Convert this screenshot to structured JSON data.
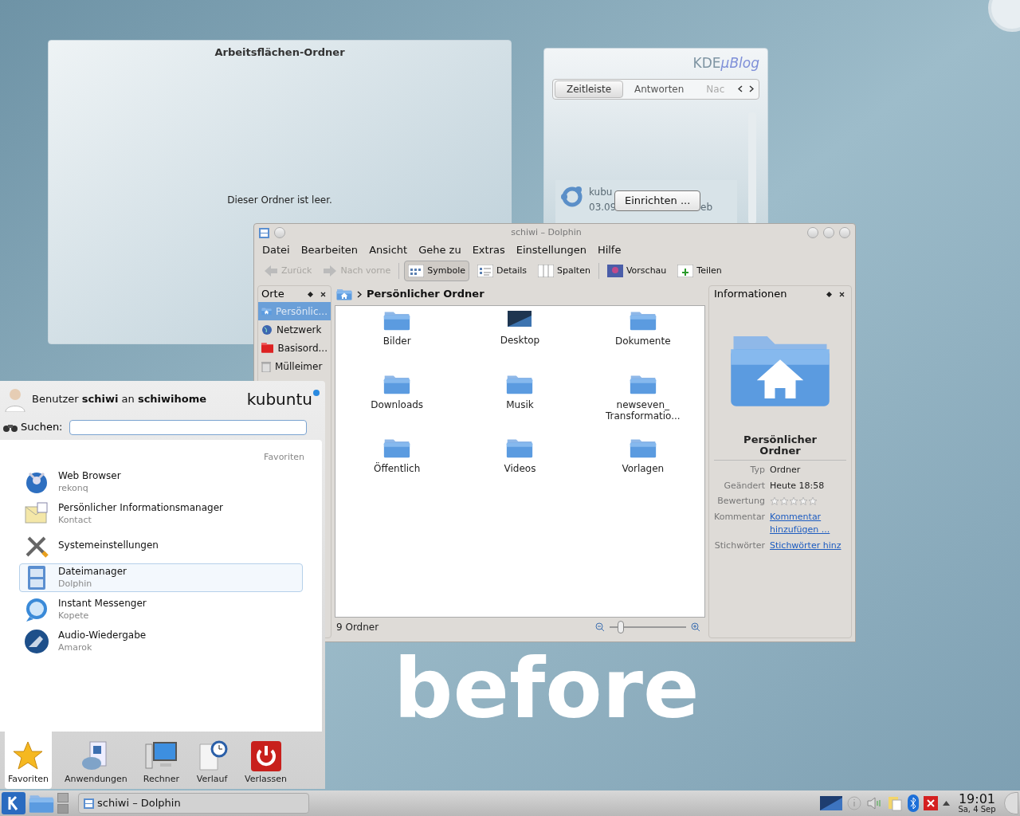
{
  "folder_view": {
    "title": "Arbeitsflächen-Ordner",
    "message": "Dieser Ordner ist leer."
  },
  "microblog": {
    "logo_main": "KDE",
    "logo_accent": "µBlog",
    "tabs": [
      {
        "label": "Zeitleiste",
        "selected": true
      },
      {
        "label": "Antworten",
        "selected": false
      },
      {
        "label": "Nac",
        "selected": false
      }
    ],
    "post": {
      "user": "kubu",
      "date": "03.09",
      "date_tail": "eb"
    },
    "configure_button": "Einrichten ..."
  },
  "dolphin": {
    "title": "schiwi – Dolphin",
    "menu": [
      "Datei",
      "Bearbeiten",
      "Ansicht",
      "Gehe zu",
      "Extras",
      "Einstellungen",
      "Hilfe"
    ],
    "toolbar": [
      {
        "label": "Zurück",
        "kind": "back",
        "disabled": true,
        "selected": false
      },
      {
        "label": "Nach vorne",
        "kind": "forward",
        "disabled": true,
        "selected": false
      },
      {
        "label": "Symbole",
        "kind": "icons",
        "disabled": false,
        "selected": true
      },
      {
        "label": "Details",
        "kind": "details",
        "disabled": false,
        "selected": false
      },
      {
        "label": "Spalten",
        "kind": "columns",
        "disabled": false,
        "selected": false
      },
      {
        "label": "Vorschau",
        "kind": "preview",
        "disabled": false,
        "selected": false
      },
      {
        "label": "Teilen",
        "kind": "split",
        "disabled": false,
        "selected": false
      }
    ],
    "places": {
      "title": "Orte",
      "items": [
        {
          "label": "Persönlic...",
          "kind": "home",
          "selected": true
        },
        {
          "label": "Netzwerk",
          "kind": "network",
          "selected": false
        },
        {
          "label": "Basisord...",
          "kind": "root",
          "selected": false
        },
        {
          "label": "Mülleimer",
          "kind": "trash",
          "selected": false
        }
      ]
    },
    "breadcrumb": "Persönlicher Ordner",
    "files": [
      {
        "name": "Bilder",
        "kind": "folder"
      },
      {
        "name": "Desktop",
        "kind": "desktop"
      },
      {
        "name": "Dokumente",
        "kind": "folder"
      },
      {
        "name": "Downloads",
        "kind": "folder"
      },
      {
        "name": "Musik",
        "kind": "folder"
      },
      {
        "name": "newseven_ Transformatio...",
        "kind": "folder"
      },
      {
        "name": "Öffentlich",
        "kind": "folder"
      },
      {
        "name": "Videos",
        "kind": "folder"
      },
      {
        "name": "Vorlagen",
        "kind": "folder"
      }
    ],
    "status": "9 Ordner",
    "zoom": {
      "level": 0.15
    },
    "info": {
      "title": "Informationen",
      "name": "Persönlicher Ordner",
      "rows": [
        {
          "label": "Typ",
          "value": "Ordner",
          "kind": "text"
        },
        {
          "label": "Geändert",
          "value": "Heute 18:58",
          "kind": "text"
        },
        {
          "label": "Bewertung",
          "kind": "rating",
          "stars": 0
        },
        {
          "label": "Kommentar",
          "value": "Kommentar hinzufügen ...",
          "kind": "link"
        },
        {
          "label": "Stichwörter",
          "value": "Stichwörter hinz",
          "kind": "link"
        }
      ]
    }
  },
  "kickoff": {
    "user_line": "Benutzer **schiwi** an **schiwihome**",
    "logo": "kubuntu",
    "search_label": "Suchen:",
    "section": "Favoriten",
    "apps": [
      {
        "name": "Web Browser",
        "sub": "rekonq",
        "kind": "browser",
        "selected": false
      },
      {
        "name": "Persönlicher Informationsmanager",
        "sub": "Kontact",
        "kind": "pim",
        "selected": false
      },
      {
        "name": "Systemeinstellungen",
        "kind": "settings",
        "selected": false
      },
      {
        "name": "Dateimanager",
        "sub": "Dolphin",
        "kind": "files",
        "selected": true
      },
      {
        "name": "Instant Messenger",
        "sub": "Kopete",
        "kind": "chat",
        "selected": false
      },
      {
        "name": "Audio-Wiedergabe",
        "sub": "Amarok",
        "kind": "audio",
        "selected": false
      }
    ],
    "tabs": [
      {
        "label": "Favoriten",
        "kind": "star",
        "selected": true
      },
      {
        "label": "Anwendungen",
        "kind": "apps",
        "selected": false
      },
      {
        "label": "Rechner",
        "kind": "computer",
        "selected": false
      },
      {
        "label": "Verlauf",
        "kind": "history",
        "selected": false
      },
      {
        "label": "Verlassen",
        "kind": "leave",
        "selected": false
      }
    ]
  },
  "taskbar": {
    "task": "schiwi – Dolphin",
    "time": "19:01",
    "date": "Sa, 4 Sep"
  },
  "caption": "before"
}
